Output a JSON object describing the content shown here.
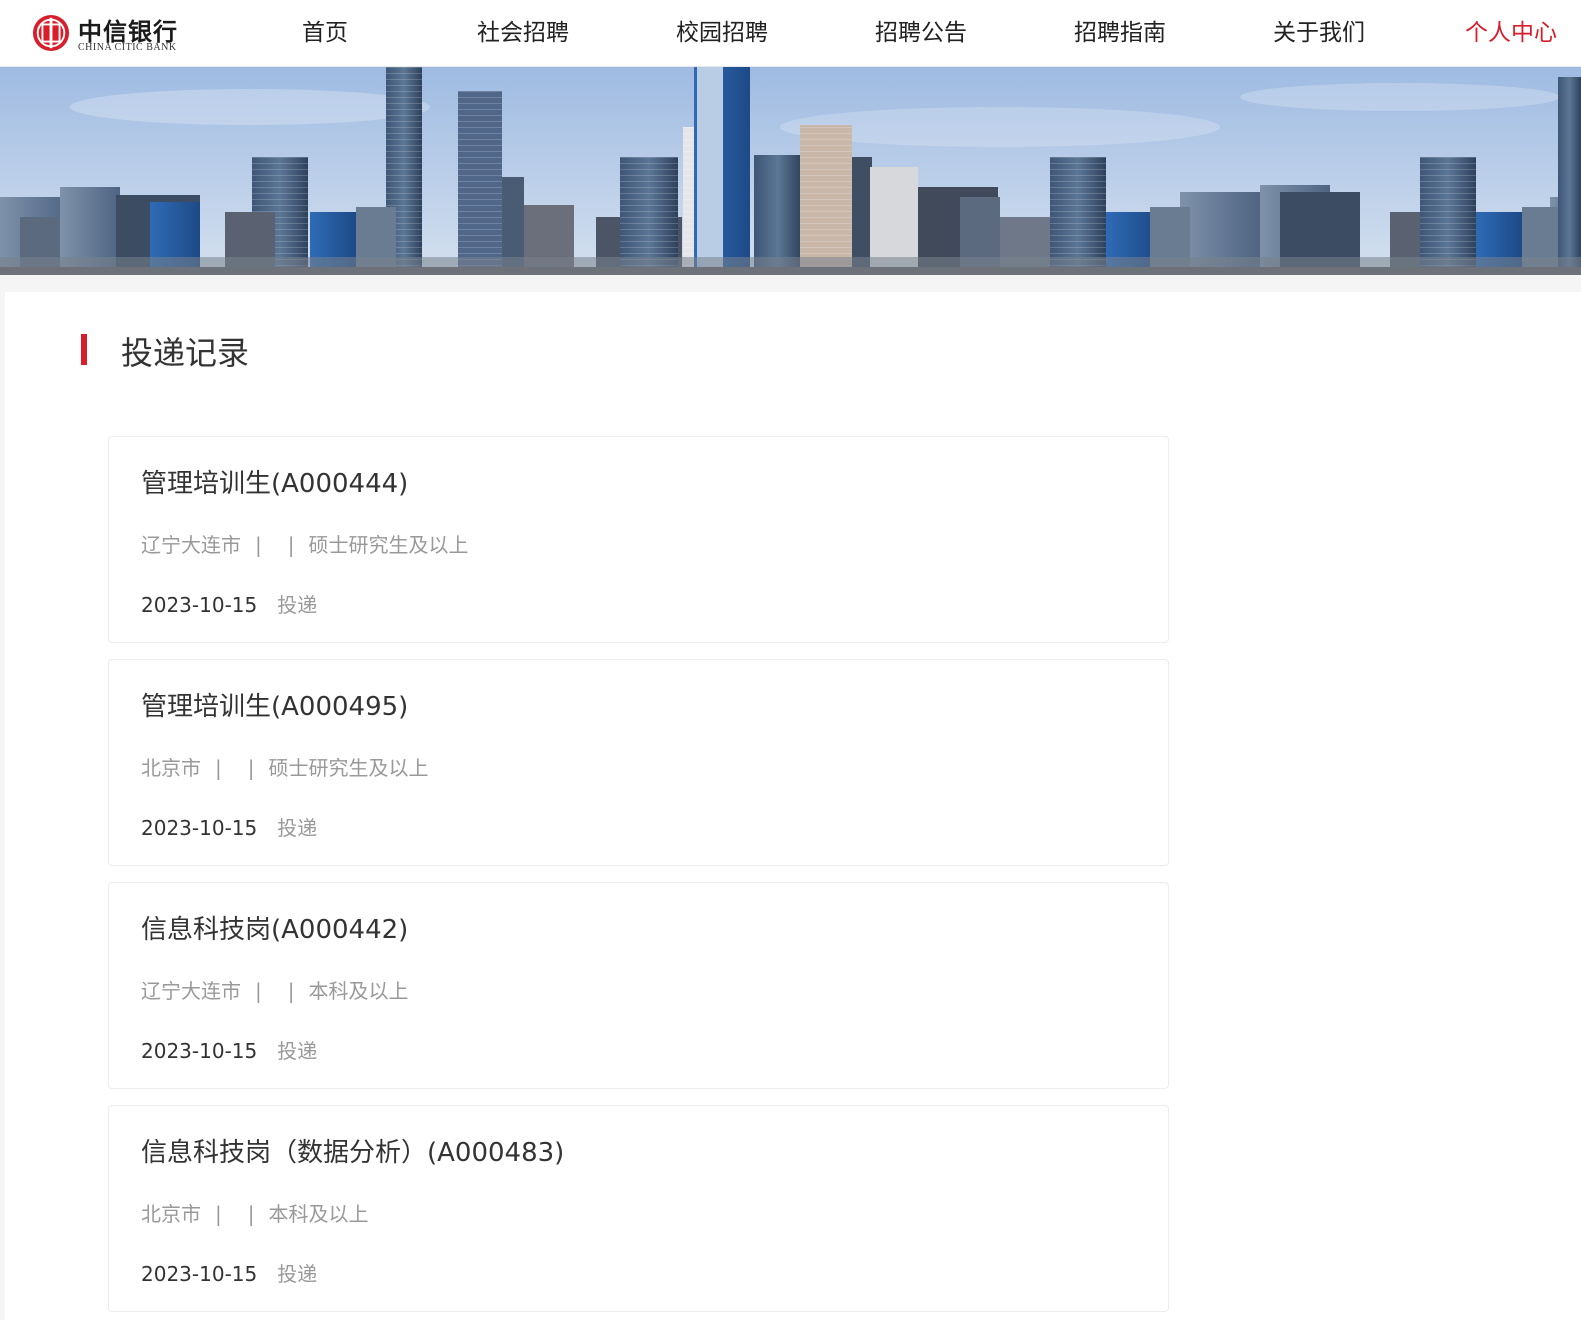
{
  "brand": {
    "name_cn": "中信银行",
    "name_en": "CHINA CITIC BANK"
  },
  "nav": {
    "items": [
      {
        "label": "首页"
      },
      {
        "label": "社会招聘"
      },
      {
        "label": "校园招聘"
      },
      {
        "label": "招聘公告"
      },
      {
        "label": "招聘指南"
      },
      {
        "label": "关于我们"
      },
      {
        "label": "个人中心",
        "active": true
      }
    ]
  },
  "page": {
    "section_title": "投递记录"
  },
  "applications": [
    {
      "title": "管理培训生(A000444)",
      "location": "辽宁大连市",
      "separator": "|",
      "department": "",
      "education": "硕士研究生及以上",
      "date": "2023-10-15",
      "status": "投递"
    },
    {
      "title": "管理培训生(A000495)",
      "location": "北京市",
      "separator": "|",
      "department": "",
      "education": "硕士研究生及以上",
      "date": "2023-10-15",
      "status": "投递"
    },
    {
      "title": "信息科技岗(A000442)",
      "location": "辽宁大连市",
      "separator": "|",
      "department": "",
      "education": "本科及以上",
      "date": "2023-10-15",
      "status": "投递"
    },
    {
      "title": "信息科技岗（数据分析）(A000483)",
      "location": "北京市",
      "separator": "|",
      "department": "",
      "education": "本科及以上",
      "date": "2023-10-15",
      "status": "投递"
    }
  ],
  "colors": {
    "accent": "#d81e2a",
    "text": "#333333",
    "muted": "#999999"
  }
}
